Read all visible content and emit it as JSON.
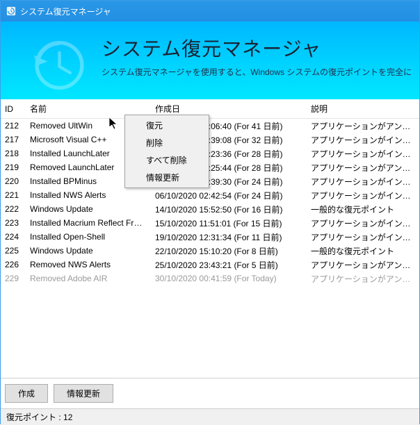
{
  "window": {
    "title": "システム復元マネージャ"
  },
  "banner": {
    "title": "システム復元マネージャ",
    "subtitle": "システム復元マネージャを使用すると、Windows システムの復元ポイントを完全に"
  },
  "columns": {
    "id": "ID",
    "name": "名前",
    "date": "作成日",
    "desc": "説明"
  },
  "rows": [
    {
      "id": "212",
      "name": "Removed UltWin",
      "date": "06/10/2020 02:06:40 (For 41 日前)",
      "desc": "アプリケーションがアンインストー"
    },
    {
      "id": "217",
      "name": "Microsoft Visual C++",
      "date": "14/10/2020 02:39:08 (For 32 日前)",
      "desc": "アプリケーションがインストールさ"
    },
    {
      "id": "218",
      "name": "Installed LaunchLater",
      "date": "18/10/2020 18:23:36 (For 28 日前)",
      "desc": "アプリケーションがインストールさ"
    },
    {
      "id": "219",
      "name": "Removed LaunchLater",
      "date": "18/10/2020 18:25:44 (For 28 日前)",
      "desc": "アプリケーションがアンインストー"
    },
    {
      "id": "220",
      "name": "Installed BPMinus",
      "date": "22/10/2020 02:39:30 (For 24 日前)",
      "desc": "アプリケーションがインストールさ"
    },
    {
      "id": "221",
      "name": "Installed NWS Alerts",
      "date": "06/10/2020 02:42:54 (For 24 日前)",
      "desc": "アプリケーションがインストールさ"
    },
    {
      "id": "222",
      "name": "Windows Update",
      "date": "14/10/2020 15:52:50 (For 16 日前)",
      "desc": "一般的な復元ポイント"
    },
    {
      "id": "223",
      "name": "Installed Macrium Reflect Free E...",
      "date": "15/10/2020 11:51:01 (For 15 日前)",
      "desc": "アプリケーションがインストールさ"
    },
    {
      "id": "224",
      "name": "Installed Open-Shell",
      "date": "19/10/2020 12:31:34 (For 11 日前)",
      "desc": "アプリケーションがインストールさ"
    },
    {
      "id": "225",
      "name": "Windows Update",
      "date": "22/10/2020 15:10:20 (For 8 日前)",
      "desc": "一般的な復元ポイント"
    },
    {
      "id": "226",
      "name": "Removed NWS Alerts",
      "date": "25/10/2020 23:43:21 (For 5 日前)",
      "desc": "アプリケーションがアンインストー"
    },
    {
      "id": "229",
      "name": "Removed Adobe AIR",
      "date": "30/10/2020 00:41:59 (For Today)",
      "desc": "アプリケーションがアンインストー",
      "disabled": true
    }
  ],
  "context_menu": {
    "items": [
      {
        "label": "復元"
      },
      {
        "label": "削除"
      },
      {
        "label": "すべて削除"
      },
      {
        "label": "情報更新"
      }
    ]
  },
  "buttons": {
    "create": "作成",
    "refresh": "情報更新"
  },
  "status": {
    "label": "復元ポイント :",
    "count": "12"
  }
}
